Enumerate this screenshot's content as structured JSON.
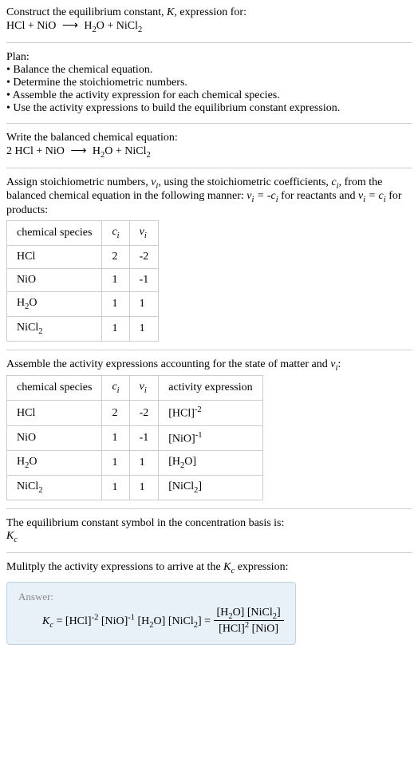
{
  "intro": {
    "line1": "Construct the equilibrium constant, ",
    "K": "K",
    "line1b": ", expression for:",
    "equation": "HCl + NiO ⟶ H₂O + NiCl₂"
  },
  "plan": {
    "title": "Plan:",
    "items": [
      "• Balance the chemical equation.",
      "• Determine the stoichiometric numbers.",
      "• Assemble the activity expression for each chemical species.",
      "• Use the activity expressions to build the equilibrium constant expression."
    ]
  },
  "balanced": {
    "title": "Write the balanced chemical equation:",
    "equation": "2 HCl + NiO ⟶ H₂O + NiCl₂"
  },
  "stoich": {
    "text1": "Assign stoichiometric numbers, ",
    "nu": "νᵢ",
    "text2": ", using the stoichiometric coefficients, ",
    "ci": "cᵢ",
    "text3": ", from the balanced chemical equation in the following manner: ",
    "eq1": "νᵢ = -cᵢ",
    "text4": " for reactants and ",
    "eq2": "νᵢ = cᵢ",
    "text5": " for products:"
  },
  "table1": {
    "headers": [
      "chemical species",
      "cᵢ",
      "νᵢ"
    ],
    "rows": [
      [
        "HCl",
        "2",
        "-2"
      ],
      [
        "NiO",
        "1",
        "-1"
      ],
      [
        "H₂O",
        "1",
        "1"
      ],
      [
        "NiCl₂",
        "1",
        "1"
      ]
    ]
  },
  "activity": {
    "text": "Assemble the activity expressions accounting for the state of matter and νᵢ:"
  },
  "table2": {
    "headers": [
      "chemical species",
      "cᵢ",
      "νᵢ",
      "activity expression"
    ],
    "rows": [
      {
        "species": "HCl",
        "c": "2",
        "nu": "-2",
        "expr": "[HCl]⁻²"
      },
      {
        "species": "NiO",
        "c": "1",
        "nu": "-1",
        "expr": "[NiO]⁻¹"
      },
      {
        "species": "H₂O",
        "c": "1",
        "nu": "1",
        "expr": "[H₂O]"
      },
      {
        "species": "NiCl₂",
        "c": "1",
        "nu": "1",
        "expr": "[NiCl₂]"
      }
    ]
  },
  "symbol": {
    "text": "The equilibrium constant symbol in the concentration basis is:",
    "value": "K_c"
  },
  "multiply": {
    "text": "Mulitply the activity expressions to arrive at the K_c expression:"
  },
  "answer": {
    "label": "Answer:",
    "lhs": "K_c = [HCl]⁻² [NiO]⁻¹ [H₂O] [NiCl₂] = ",
    "num": "[H₂O] [NiCl₂]",
    "den": "[HCl]² [NiO]"
  }
}
